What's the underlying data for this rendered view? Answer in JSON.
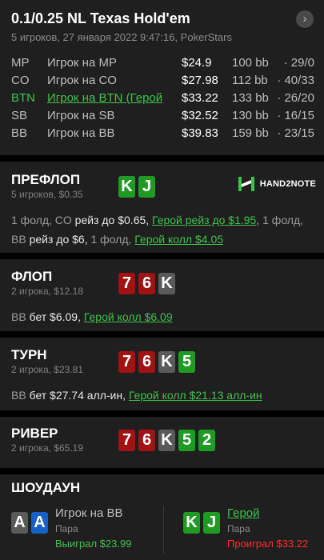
{
  "header": {
    "title": "0.1/0.25 NL Texas Hold'em",
    "subtitle": "5 игроков, 27 января 2022 9:47:16, PokerStars",
    "next_icon": "chevron-right-icon"
  },
  "players": [
    {
      "pos": "MP",
      "name": "Игрок на MP",
      "stack": "$24.9",
      "bb": "100 bb",
      "stats": "· 29/0",
      "hero": false
    },
    {
      "pos": "CO",
      "name": "Игрок на CO",
      "stack": "$27.98",
      "bb": "112 bb",
      "stats": "· 40/33",
      "hero": false
    },
    {
      "pos": "BTN",
      "name": "Игрок на BTN (Герой",
      "stack": "$33.22",
      "bb": "133 bb",
      "stats": "· 26/20",
      "hero": true
    },
    {
      "pos": "SB",
      "name": "Игрок на SB",
      "stack": "$32.52",
      "bb": "130 bb",
      "stats": "· 16/15",
      "hero": false
    },
    {
      "pos": "BB",
      "name": "Игрок на BB",
      "stack": "$39.83",
      "bb": "159 bb",
      "stats": "· 23/15",
      "hero": false
    }
  ],
  "logo_text": "HAND2NOTE",
  "streets": {
    "preflop": {
      "title": "ПРЕФЛОП",
      "sub": "5 игроков, $0.35",
      "cards": [
        {
          "rank": "K",
          "color": "green"
        },
        {
          "rank": "J",
          "color": "green"
        }
      ],
      "actions": [
        {
          "t": "1 фолд, ",
          "c": "grey"
        },
        {
          "t": "CO",
          "c": "grey"
        },
        {
          "t": " рейз до $0.65, ",
          "c": "white"
        },
        {
          "t": "Герой рейз до $1.95",
          "c": "green"
        },
        {
          "t": ", 1 фолд, ",
          "c": "grey"
        },
        {
          "t": "BB",
          "c": "grey"
        },
        {
          "t": " рейз до $6, ",
          "c": "white"
        },
        {
          "t": "1 фолд, ",
          "c": "grey"
        },
        {
          "t": "Герой колл $4.05",
          "c": "green"
        }
      ]
    },
    "flop": {
      "title": "ФЛОП",
      "sub": "2 игрока, $12.18",
      "cards": [
        {
          "rank": "7",
          "color": "red"
        },
        {
          "rank": "6",
          "color": "red"
        },
        {
          "rank": "K",
          "color": "grey"
        }
      ],
      "actions": [
        {
          "t": "BB",
          "c": "grey"
        },
        {
          "t": " бет $6.09, ",
          "c": "white"
        },
        {
          "t": "Герой колл $6.09",
          "c": "green"
        }
      ]
    },
    "turn": {
      "title": "ТУРН",
      "sub": "2 игрока, $23.81",
      "cards": [
        {
          "rank": "7",
          "color": "red"
        },
        {
          "rank": "6",
          "color": "red"
        },
        {
          "rank": "K",
          "color": "grey"
        },
        {
          "rank": "5",
          "color": "green"
        }
      ],
      "actions": [
        {
          "t": "BB",
          "c": "grey"
        },
        {
          "t": " бет $27.74 алл-ин, ",
          "c": "white"
        },
        {
          "t": "Герой колл $21.13 алл-ин",
          "c": "green"
        }
      ]
    },
    "river": {
      "title": "РИВЕР",
      "sub": "2 игрока, $65.19",
      "cards": [
        {
          "rank": "7",
          "color": "red"
        },
        {
          "rank": "6",
          "color": "red"
        },
        {
          "rank": "K",
          "color": "grey"
        },
        {
          "rank": "5",
          "color": "green"
        },
        {
          "rank": "2",
          "color": "green"
        }
      ]
    }
  },
  "showdown": {
    "title": "ШОУДАУН",
    "left": {
      "cards": [
        {
          "rank": "A",
          "color": "grey"
        },
        {
          "rank": "A",
          "color": "blue"
        }
      ],
      "name": "Игрок на BB",
      "hand": "Пара",
      "result": "Выиграл $23.99",
      "result_color": "#3fc24a"
    },
    "right": {
      "cards": [
        {
          "rank": "K",
          "color": "green"
        },
        {
          "rank": "J",
          "color": "green"
        }
      ],
      "name": "Герой",
      "hand": "Пара",
      "result": "Проиграл $33.22",
      "result_color": "#ff2b2b"
    }
  },
  "colors": {
    "green": "#1f9a22",
    "red": "#a11212",
    "grey": "#5a5a5a",
    "blue": "#1662c8",
    "hero_text": "#3fc24a",
    "background": "#1f1f1f"
  }
}
